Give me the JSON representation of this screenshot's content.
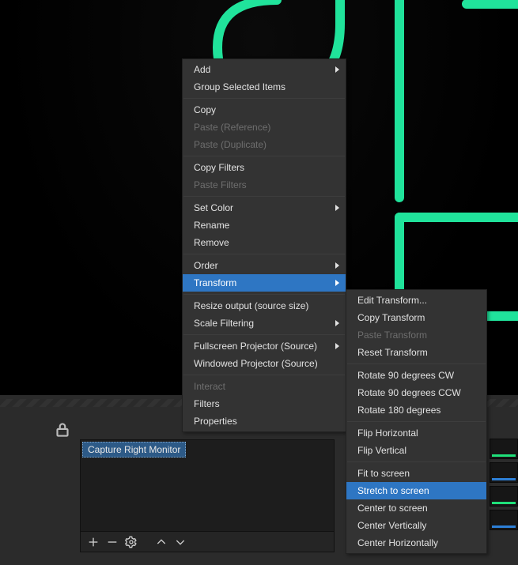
{
  "source_item_label": "Capture Right Monitor",
  "menu": {
    "add": "Add",
    "group": "Group Selected Items",
    "copy": "Copy",
    "paste_ref": "Paste (Reference)",
    "paste_dup": "Paste (Duplicate)",
    "copy_filters": "Copy Filters",
    "paste_filters": "Paste Filters",
    "set_color": "Set Color",
    "rename": "Rename",
    "remove": "Remove",
    "order": "Order",
    "transform": "Transform",
    "resize_output": "Resize output (source size)",
    "scale_filtering": "Scale Filtering",
    "fullscreen_proj": "Fullscreen Projector (Source)",
    "windowed_proj": "Windowed Projector (Source)",
    "interact": "Interact",
    "filters": "Filters",
    "properties": "Properties"
  },
  "submenu": {
    "edit_transform": "Edit Transform...",
    "copy_transform": "Copy Transform",
    "paste_transform": "Paste Transform",
    "reset_transform": "Reset Transform",
    "rotate_cw": "Rotate 90 degrees CW",
    "rotate_ccw": "Rotate 90 degrees CCW",
    "rotate_180": "Rotate 180 degrees",
    "flip_h": "Flip Horizontal",
    "flip_v": "Flip Vertical",
    "fit": "Fit to screen",
    "stretch": "Stretch to screen",
    "center": "Center to screen",
    "center_v": "Center Vertically",
    "center_h": "Center Horizontally"
  }
}
